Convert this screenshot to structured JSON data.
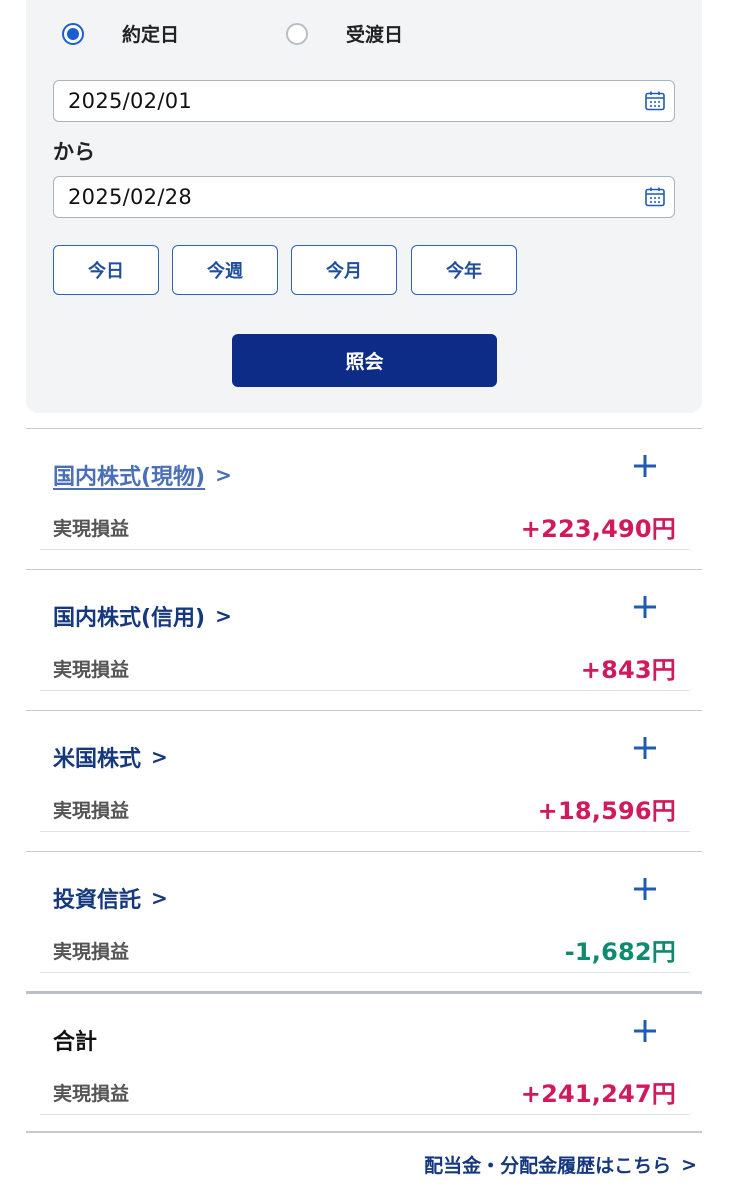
{
  "filter": {
    "radio_options": [
      {
        "label": "約定日",
        "selected": true
      },
      {
        "label": "受渡日",
        "selected": false
      }
    ],
    "from_date": "2025/02/01",
    "separator": "から",
    "to_date": "2025/02/28",
    "quick_buttons": [
      "今日",
      "今週",
      "今月",
      "今年"
    ],
    "submit_label": "照会"
  },
  "sections": [
    {
      "title": "国内株式(現物)",
      "label": "実現損益",
      "value": "+223,490円",
      "sign": "positive"
    },
    {
      "title": "国内株式(信用)",
      "label": "実現損益",
      "value": "+843円",
      "sign": "positive"
    },
    {
      "title": "米国株式",
      "label": "実現損益",
      "value": "+18,596円",
      "sign": "positive"
    },
    {
      "title": "投資信託",
      "label": "実現損益",
      "value": "-1,682円",
      "sign": "negative"
    }
  ],
  "total": {
    "title": "合計",
    "label": "実現損益",
    "value": "+241,247円",
    "sign": "positive"
  },
  "footer_link": "配当金・分配金履歴はこちら",
  "colors": {
    "positive": "#d1195e",
    "negative": "#0f8a6f",
    "accent": "#0d2c87"
  }
}
